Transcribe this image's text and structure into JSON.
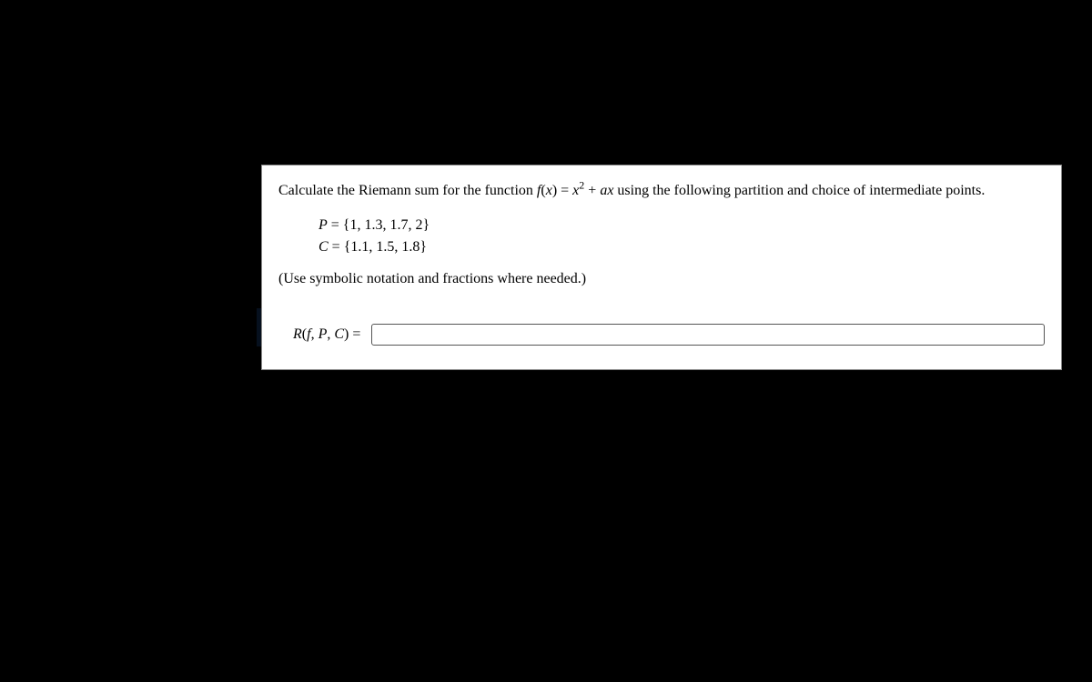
{
  "question": {
    "intro_pre": "Calculate the Riemann sum for the function ",
    "func_f": "f",
    "func_x_open": "(",
    "func_var": "x",
    "func_x_close": ") = ",
    "func_rhs_x": "x",
    "func_exp": "2",
    "func_plus": " + ",
    "func_a": "a",
    "func_x2": "x",
    "intro_post": " using the following partition and choice of intermediate points."
  },
  "given": {
    "P_label": "P",
    "P_eq": " = {1, 1.3, 1.7, 2}",
    "C_label": "C",
    "C_eq": " = {1.1, 1.5, 1.8}"
  },
  "note": "(Use symbolic notation and fractions where needed.)",
  "answer": {
    "R": "R",
    "open": "(",
    "f": "f",
    "comma1": ", ",
    "P": "P",
    "comma2": ", ",
    "C": "C",
    "close": ") =",
    "value": ""
  }
}
